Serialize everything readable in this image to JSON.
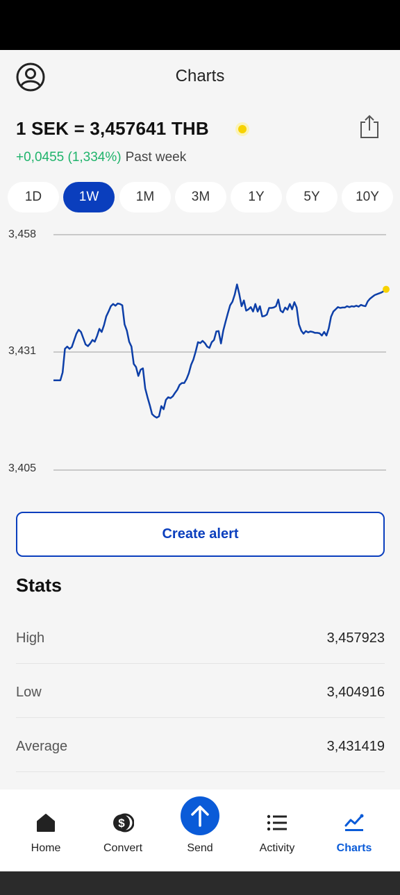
{
  "header": {
    "title": "Charts"
  },
  "rate": {
    "text": "1 SEK = 3,457641 THB",
    "change": "+0,0455 (1,334%)",
    "period": "Past week"
  },
  "tabs": [
    {
      "label": "1D",
      "active": false
    },
    {
      "label": "1W",
      "active": true
    },
    {
      "label": "1M",
      "active": false
    },
    {
      "label": "3M",
      "active": false
    },
    {
      "label": "1Y",
      "active": false
    },
    {
      "label": "5Y",
      "active": false
    },
    {
      "label": "10Y",
      "active": false
    }
  ],
  "chart_data": {
    "type": "line",
    "ylim": [
      3.405,
      3.458
    ],
    "yticks": [
      "3,458",
      "3,431",
      "3,405"
    ],
    "grid": true,
    "series": [
      {
        "values": [
          3.4252,
          3.4252,
          3.4252,
          3.4252,
          3.427,
          3.4323,
          3.4328,
          3.4323,
          3.4327,
          3.4342,
          3.4357,
          3.4366,
          3.4361,
          3.4347,
          3.4333,
          3.4329,
          3.4335,
          3.4343,
          3.4339,
          3.4352,
          3.4368,
          3.4361,
          3.4376,
          3.4396,
          3.4407,
          3.4419,
          3.4424,
          3.442,
          3.4425,
          3.4424,
          3.4421,
          3.4378,
          3.4364,
          3.4339,
          3.4328,
          3.4289,
          3.4282,
          3.4262,
          3.4276,
          3.4279,
          3.4234,
          3.4214,
          3.4196,
          3.4176,
          3.4171,
          3.4168,
          3.4171,
          3.4194,
          3.4187,
          3.4208,
          3.4214,
          3.4212,
          3.4216,
          3.4224,
          3.4231,
          3.4242,
          3.4246,
          3.4246,
          3.4255,
          3.4268,
          3.4287,
          3.4299,
          3.4317,
          3.4338,
          3.4336,
          3.4341,
          3.4336,
          3.4328,
          3.4325,
          3.4338,
          3.4343,
          3.4362,
          3.4363,
          3.4335,
          3.4364,
          3.4384,
          3.4403,
          3.4421,
          3.4429,
          3.4445,
          3.4468,
          3.4446,
          3.4419,
          3.4432,
          3.4409,
          3.4412,
          3.4417,
          3.4407,
          3.4424,
          3.4407,
          3.4419,
          3.4396,
          3.4397,
          3.44,
          3.4415,
          3.4415,
          3.4416,
          3.4419,
          3.4434,
          3.4409,
          3.4405,
          3.4416,
          3.4411,
          3.4424,
          3.4412,
          3.4428,
          3.4416,
          3.4378,
          3.4364,
          3.4357,
          3.4363,
          3.436,
          3.4362,
          3.4361,
          3.4359,
          3.4359,
          3.4358,
          3.4353,
          3.4361,
          3.4353,
          3.4369,
          3.4395,
          3.4407,
          3.4412,
          3.4417,
          3.4415,
          3.4416,
          3.4416,
          3.4419,
          3.4417,
          3.4419,
          3.4418,
          3.442,
          3.4418,
          3.4422,
          3.442,
          3.4419,
          3.443,
          3.4436,
          3.444,
          3.4444,
          3.4446,
          3.4448,
          3.445,
          3.4453,
          3.4457
        ]
      }
    ]
  },
  "actions": {
    "create_alert": "Create alert"
  },
  "stats": {
    "title": "Stats",
    "rows": [
      {
        "label": "High",
        "value": "3,457923"
      },
      {
        "label": "Low",
        "value": "3,404916"
      },
      {
        "label": "Average",
        "value": "3,431419"
      }
    ]
  },
  "nav": [
    {
      "label": "Home",
      "icon": "home-icon"
    },
    {
      "label": "Convert",
      "icon": "convert-icon"
    },
    {
      "label": "Send",
      "icon": "send-icon"
    },
    {
      "label": "Activity",
      "icon": "activity-icon"
    },
    {
      "label": "Charts",
      "icon": "charts-icon",
      "active": true
    }
  ],
  "colors": {
    "accent": "#0a3ebd",
    "positive": "#1fb36b",
    "line": "#0d3fa8",
    "live_dot": "#f7d200"
  }
}
